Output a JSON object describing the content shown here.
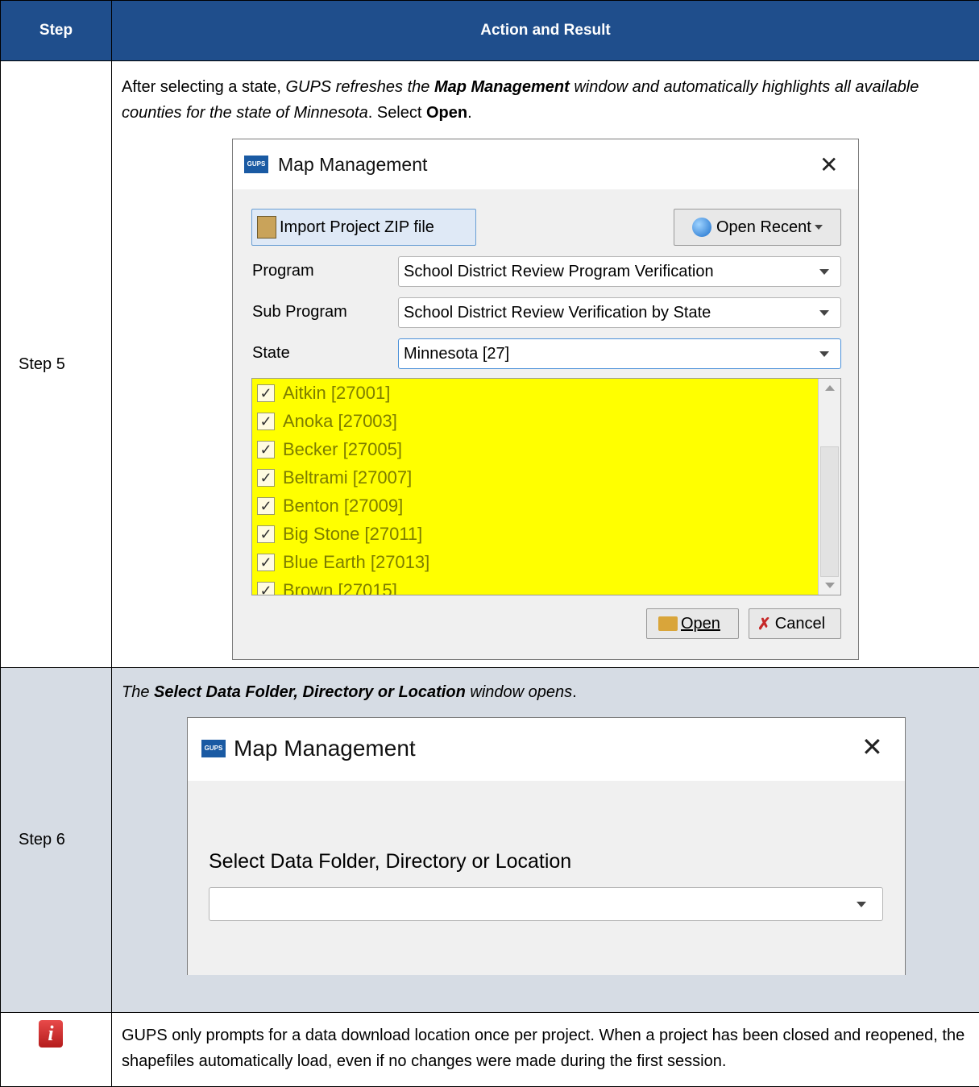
{
  "header": {
    "step": "Step",
    "action": "Action and Result"
  },
  "rows": [
    {
      "step": "Step 5",
      "text": {
        "a": "After selecting a state, ",
        "b": "GUPS refreshes the ",
        "c": "Map Management",
        "d": " window and automatically highlights all available counties for the state of Minnesota",
        "e": ". Select ",
        "f": "Open",
        "g": "."
      },
      "dialog": {
        "title": "Map Management",
        "logo": "GUPS",
        "import_button": "Import Project ZIP file",
        "open_recent": "Open Recent",
        "program_label": "Program",
        "program_value": "School District Review Program Verification",
        "subprogram_label": "Sub Program",
        "subprogram_value": "School District Review Verification by State",
        "state_label": "State",
        "state_value": "Minnesota [27]",
        "counties": [
          "Aitkin [27001]",
          "Anoka [27003]",
          "Becker [27005]",
          "Beltrami [27007]",
          "Benton [27009]",
          "Big Stone [27011]",
          "Blue Earth [27013]",
          "Brown [27015]"
        ],
        "open_button": "Open",
        "cancel_button": "Cancel"
      }
    },
    {
      "step": "Step 6",
      "text": {
        "a": "The ",
        "b": "Select Data Folder, Directory or Location",
        "c": " window opens",
        "d": "."
      },
      "dialog": {
        "title": "Map Management",
        "logo": "GUPS",
        "field_label": "Select Data Folder, Directory or Location",
        "field_value": ""
      }
    }
  ],
  "note": {
    "icon": "info-icon",
    "glyph": "i",
    "text": "GUPS only prompts for a data download location once per project. When a project has been closed and reopened, the shapefiles automatically load, even if no changes were made during the first session."
  },
  "colors": {
    "header_bg": "#1f4e8c",
    "step6_bg": "#d6dce4",
    "highlight": "#ffff00"
  }
}
